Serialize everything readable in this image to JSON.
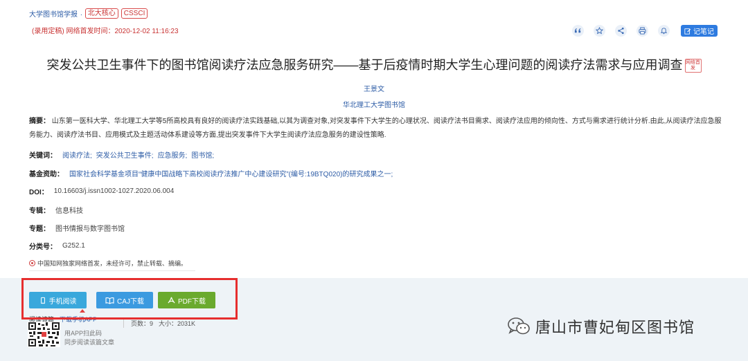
{
  "header": {
    "journal": "大学图书馆学报",
    "journal_sep": ".",
    "badges": [
      "北大核心",
      "CSSCI"
    ],
    "pub_time": "(录用定稿) 网络首发时间：2020-12-02 11:16:23",
    "note_button": "记笔记"
  },
  "article": {
    "title": "突发公共卫生事件下的图书馆阅读疗法应急服务研究——基于后疫情时期大学生心理问题的阅读疗法需求与应用调查",
    "net_badge": "网络首发",
    "author": "王景文",
    "org": "华北理工大学图书馆",
    "abstract_label": "摘要：",
    "abstract": "山东第一医科大学、华北理工大学等5所高校具有良好的阅读疗法实践基础,以其为调查对象,对突发事件下大学生的心理状况、阅读疗法书目需求、阅读疗法应用的倾向性、方式与需求进行统计分析.由此,从阅读疗法应急服务能力、阅读疗法书目、应用模式及主题活动体系建设等方面,提出突发事件下大学生阅读疗法应急服务的建设性策略.",
    "keywords_label": "关键词：",
    "keywords": [
      "阅读疗法;",
      "突发公共卫生事件;",
      "应急服务;",
      "图书馆;"
    ],
    "fund_label": "基金资助：",
    "fund": "国家社会科学基金项目“健康中国战略下高校阅读疗法推广中心建设研究”(编号:19BTQ020)的研究成果之一;",
    "doi_label": "DOI：",
    "doi": "10.16603/j.issn1002-1027.2020.06.004",
    "series_label": "专辑：",
    "series": "信息科技",
    "topic_label": "专题：",
    "topic": "图书情报与数字图书馆",
    "class_label": "分类号：",
    "class": "G252.1",
    "notice": "中国知网独家网络首发，未经许可，禁止转载、摘编。"
  },
  "downloads": {
    "mobile": "手机阅读",
    "caj": "CAJ下载",
    "pdf": "PDF下载"
  },
  "footer": {
    "read_app": "阅读该篇",
    "download_app": "下载手机APP",
    "qr_line1": "用APP扫此码",
    "qr_line2": "同步阅读该篇文章",
    "pages": "页数：9",
    "size": "大小：2031K"
  },
  "watermark": "唐山市曹妃甸区图书馆",
  "colors": {
    "accent_blue": "#2d5ca6",
    "highlight_red": "#e62e2e",
    "pdf_green": "#6aaa2e"
  }
}
